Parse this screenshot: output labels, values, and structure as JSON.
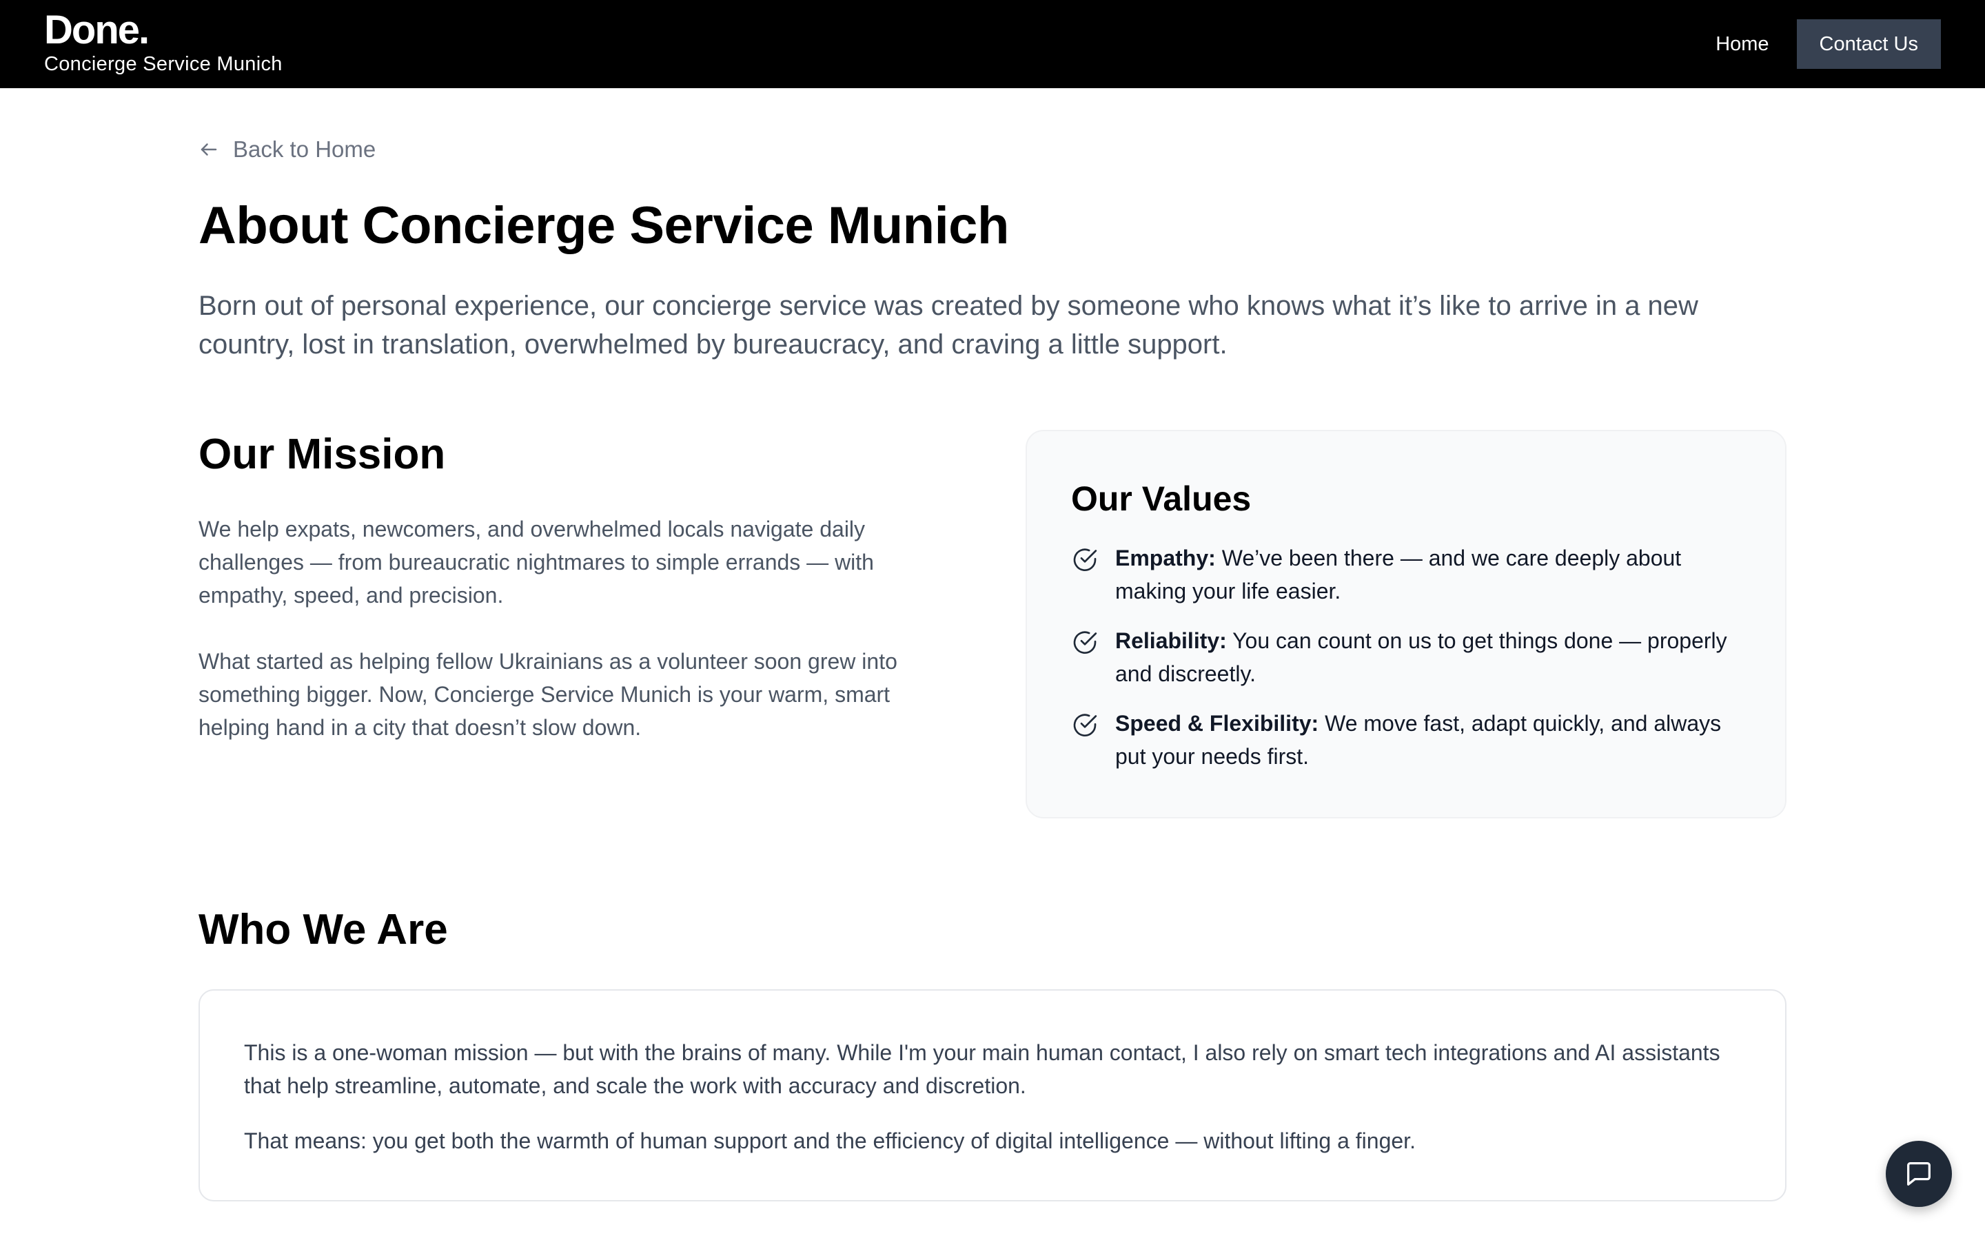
{
  "header": {
    "logo": "Done.",
    "subtitle": "Concierge Service Munich",
    "nav": {
      "home": "Home",
      "contact": "Contact Us"
    }
  },
  "back_link": {
    "label": "Back to Home",
    "icon": "arrow-left-icon"
  },
  "page": {
    "title": "About Concierge Service Munich",
    "intro": "Born out of personal experience, our concierge service was created by someone who knows what it’s like to arrive in a new country, lost in translation, overwhelmed by bureaucracy, and craving a little support."
  },
  "mission": {
    "title": "Our Mission",
    "paragraphs": [
      "We help expats, newcomers, and overwhelmed locals navigate daily challenges — from bureaucratic nightmares to simple errands — with empathy, speed, and precision.",
      "What started as helping fellow Ukrainians as a volunteer soon grew into something bigger. Now, Concierge Service Munich is your warm, smart helping hand in a city that doesn’t slow down."
    ]
  },
  "values": {
    "title": "Our Values",
    "items": [
      {
        "label": "Empathy:",
        "text": "We’ve been there — and we care deeply about making your life easier.",
        "icon": "check-circle-icon"
      },
      {
        "label": "Reliability:",
        "text": "You can count on us to get things done — properly and discreetly.",
        "icon": "check-circle-icon"
      },
      {
        "label": "Speed & Flexibility:",
        "text": "We move fast, adapt quickly, and always put your needs first.",
        "icon": "check-circle-icon"
      }
    ]
  },
  "who": {
    "title": "Who We Are",
    "paragraphs": [
      "This is a one-woman mission — but with the brains of many. While I'm your main human contact, I also rely on smart tech integrations and AI assistants that help streamline, automate, and scale the work with accuracy and discretion.",
      "That means: you get both the warmth of human support and the efficiency of digital intelligence — without lifting a finger."
    ]
  },
  "chat": {
    "icon": "chat-bubble-icon"
  },
  "colors": {
    "header_bg": "#000000",
    "contact_button_bg": "#374151",
    "muted_text": "#4b5563",
    "card_bg": "#f9fafb",
    "chat_button_bg": "#1f2937"
  }
}
